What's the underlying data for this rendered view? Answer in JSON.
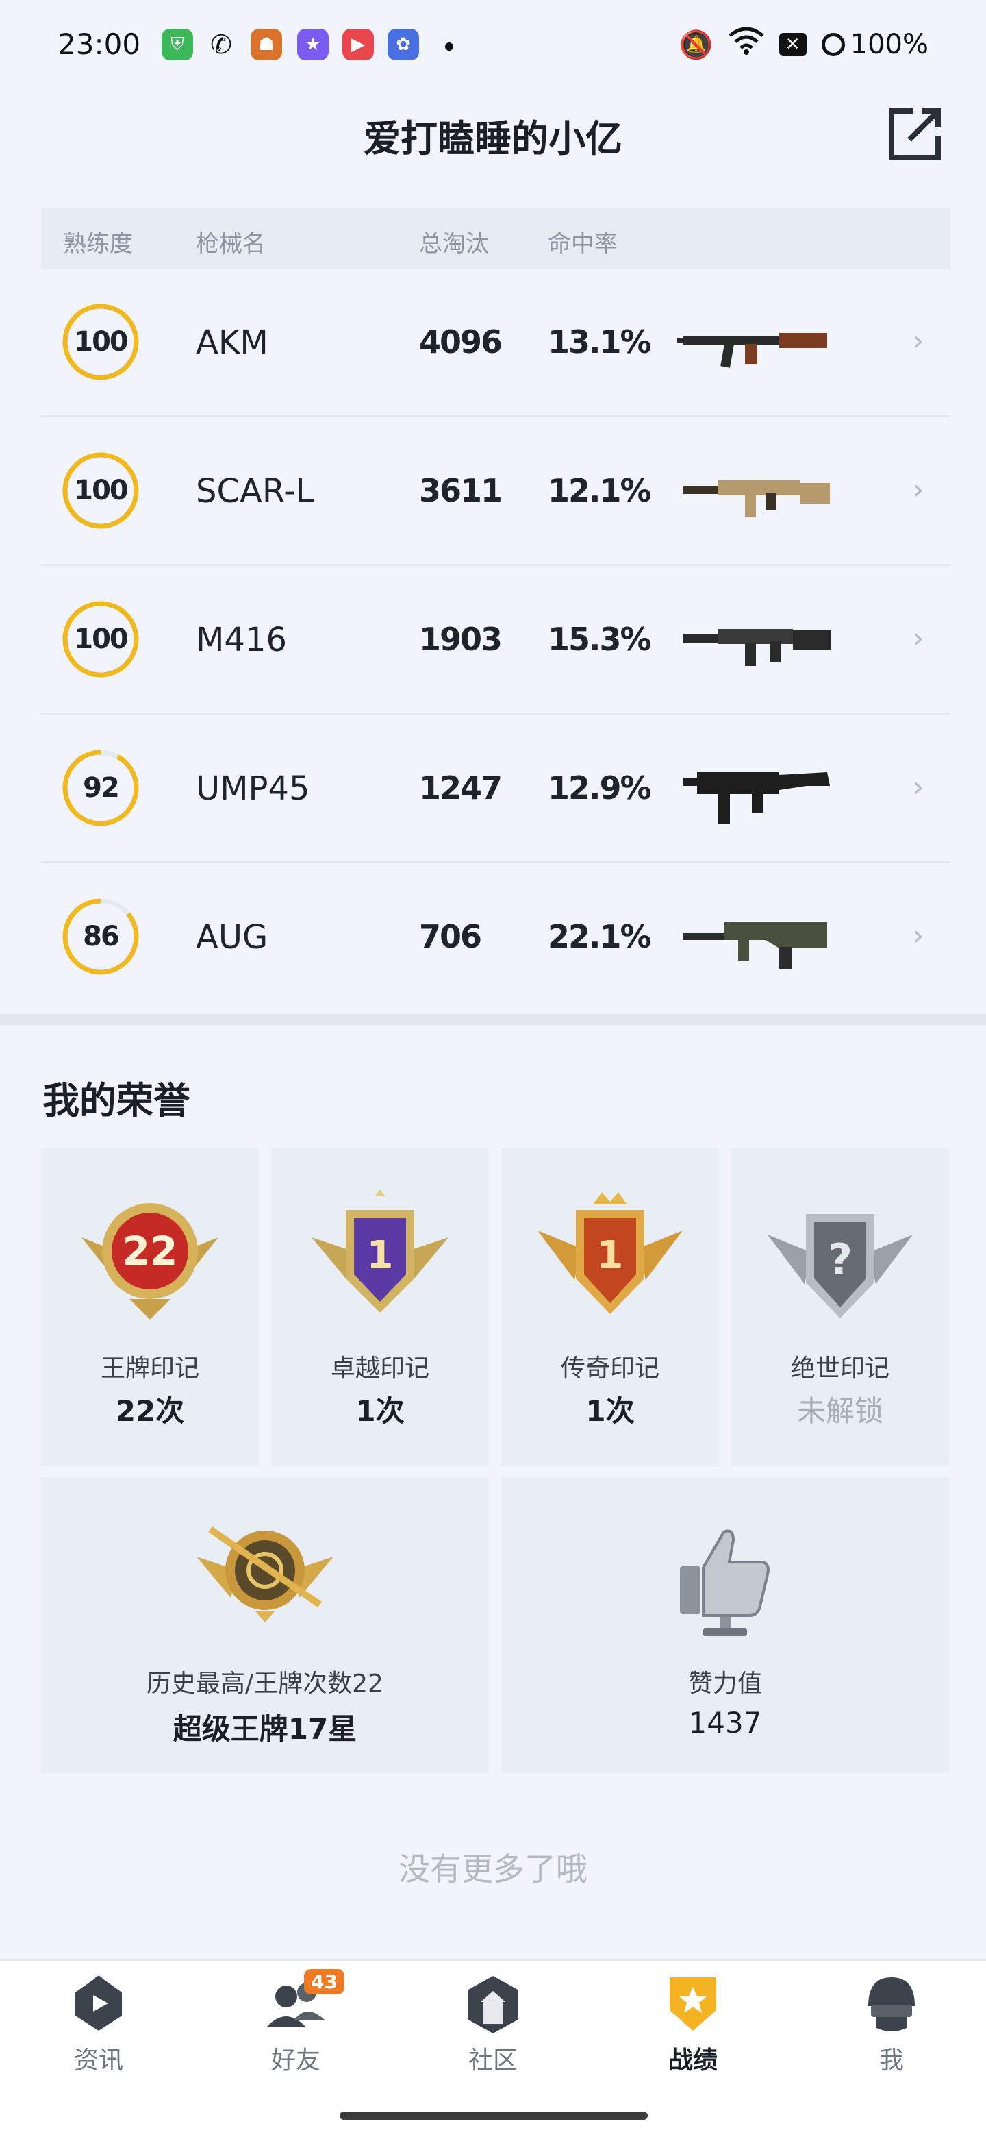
{
  "status_bar": {
    "time": "23:00",
    "battery": "100%",
    "icons": [
      "shield-app-icon",
      "wechat-icon",
      "game-app-icon",
      "star-app-icon",
      "video-app-icon",
      "anime-app-icon",
      "mute-icon",
      "wifi-icon",
      "sim-off-icon",
      "battery-icon"
    ]
  },
  "header": {
    "title": "爱打瞌睡的小亿"
  },
  "weapon_table": {
    "columns": [
      "熟练度",
      "枪械名",
      "总淘汰",
      "命中率"
    ],
    "rows": [
      {
        "mastery": 100,
        "mastery_display": "100",
        "name": "AKM",
        "kills": "4096",
        "hit_rate": "13.1%",
        "weapon_icon": "akm-rifle-icon"
      },
      {
        "mastery": 100,
        "mastery_display": "100",
        "name": "SCAR-L",
        "kills": "3611",
        "hit_rate": "12.1%",
        "weapon_icon": "scar-l-rifle-icon"
      },
      {
        "mastery": 100,
        "mastery_display": "100",
        "name": "M416",
        "kills": "1903",
        "hit_rate": "15.3%",
        "weapon_icon": "m416-rifle-icon"
      },
      {
        "mastery": 92,
        "mastery_display": "92",
        "name": "UMP45",
        "kills": "1247",
        "hit_rate": "12.9%",
        "weapon_icon": "ump45-smg-icon"
      },
      {
        "mastery": 86,
        "mastery_display": "86",
        "name": "AUG",
        "kills": "706",
        "hit_rate": "22.1%",
        "weapon_icon": "aug-rifle-icon"
      }
    ],
    "ring_color": "#f2b81f",
    "ring_track_color": "#e6e9ee"
  },
  "honors": {
    "title": "我的荣誉",
    "marks": [
      {
        "label": "王牌印记",
        "count": "22次",
        "medal_number": "22",
        "icon": "ace-mark-medal-icon",
        "locked": false
      },
      {
        "label": "卓越印记",
        "count": "1次",
        "medal_number": "1",
        "icon": "excellence-mark-medal-icon",
        "locked": false
      },
      {
        "label": "传奇印记",
        "count": "1次",
        "medal_number": "1",
        "icon": "legend-mark-medal-icon",
        "locked": false
      },
      {
        "label": "绝世印记",
        "count": "未解锁",
        "medal_number": "?",
        "icon": "peerless-mark-medal-icon",
        "locked": true
      }
    ],
    "highest": {
      "label": "历史最高/王牌次数22",
      "value": "超级王牌17星",
      "icon": "super-ace-badge-icon"
    },
    "likes": {
      "label": "赞力值",
      "value": "1437",
      "icon": "thumbs-up-trophy-icon"
    }
  },
  "footer_text": "没有更多了哦",
  "bottom_nav": {
    "items": [
      {
        "label": "资讯",
        "icon": "news-icon",
        "active": false
      },
      {
        "label": "好友",
        "icon": "friends-icon",
        "active": false,
        "badge": "43"
      },
      {
        "label": "社区",
        "icon": "community-icon",
        "active": false
      },
      {
        "label": "战绩",
        "icon": "record-shield-icon",
        "active": true
      },
      {
        "label": "我",
        "icon": "helmet-profile-icon",
        "active": false
      }
    ]
  }
}
